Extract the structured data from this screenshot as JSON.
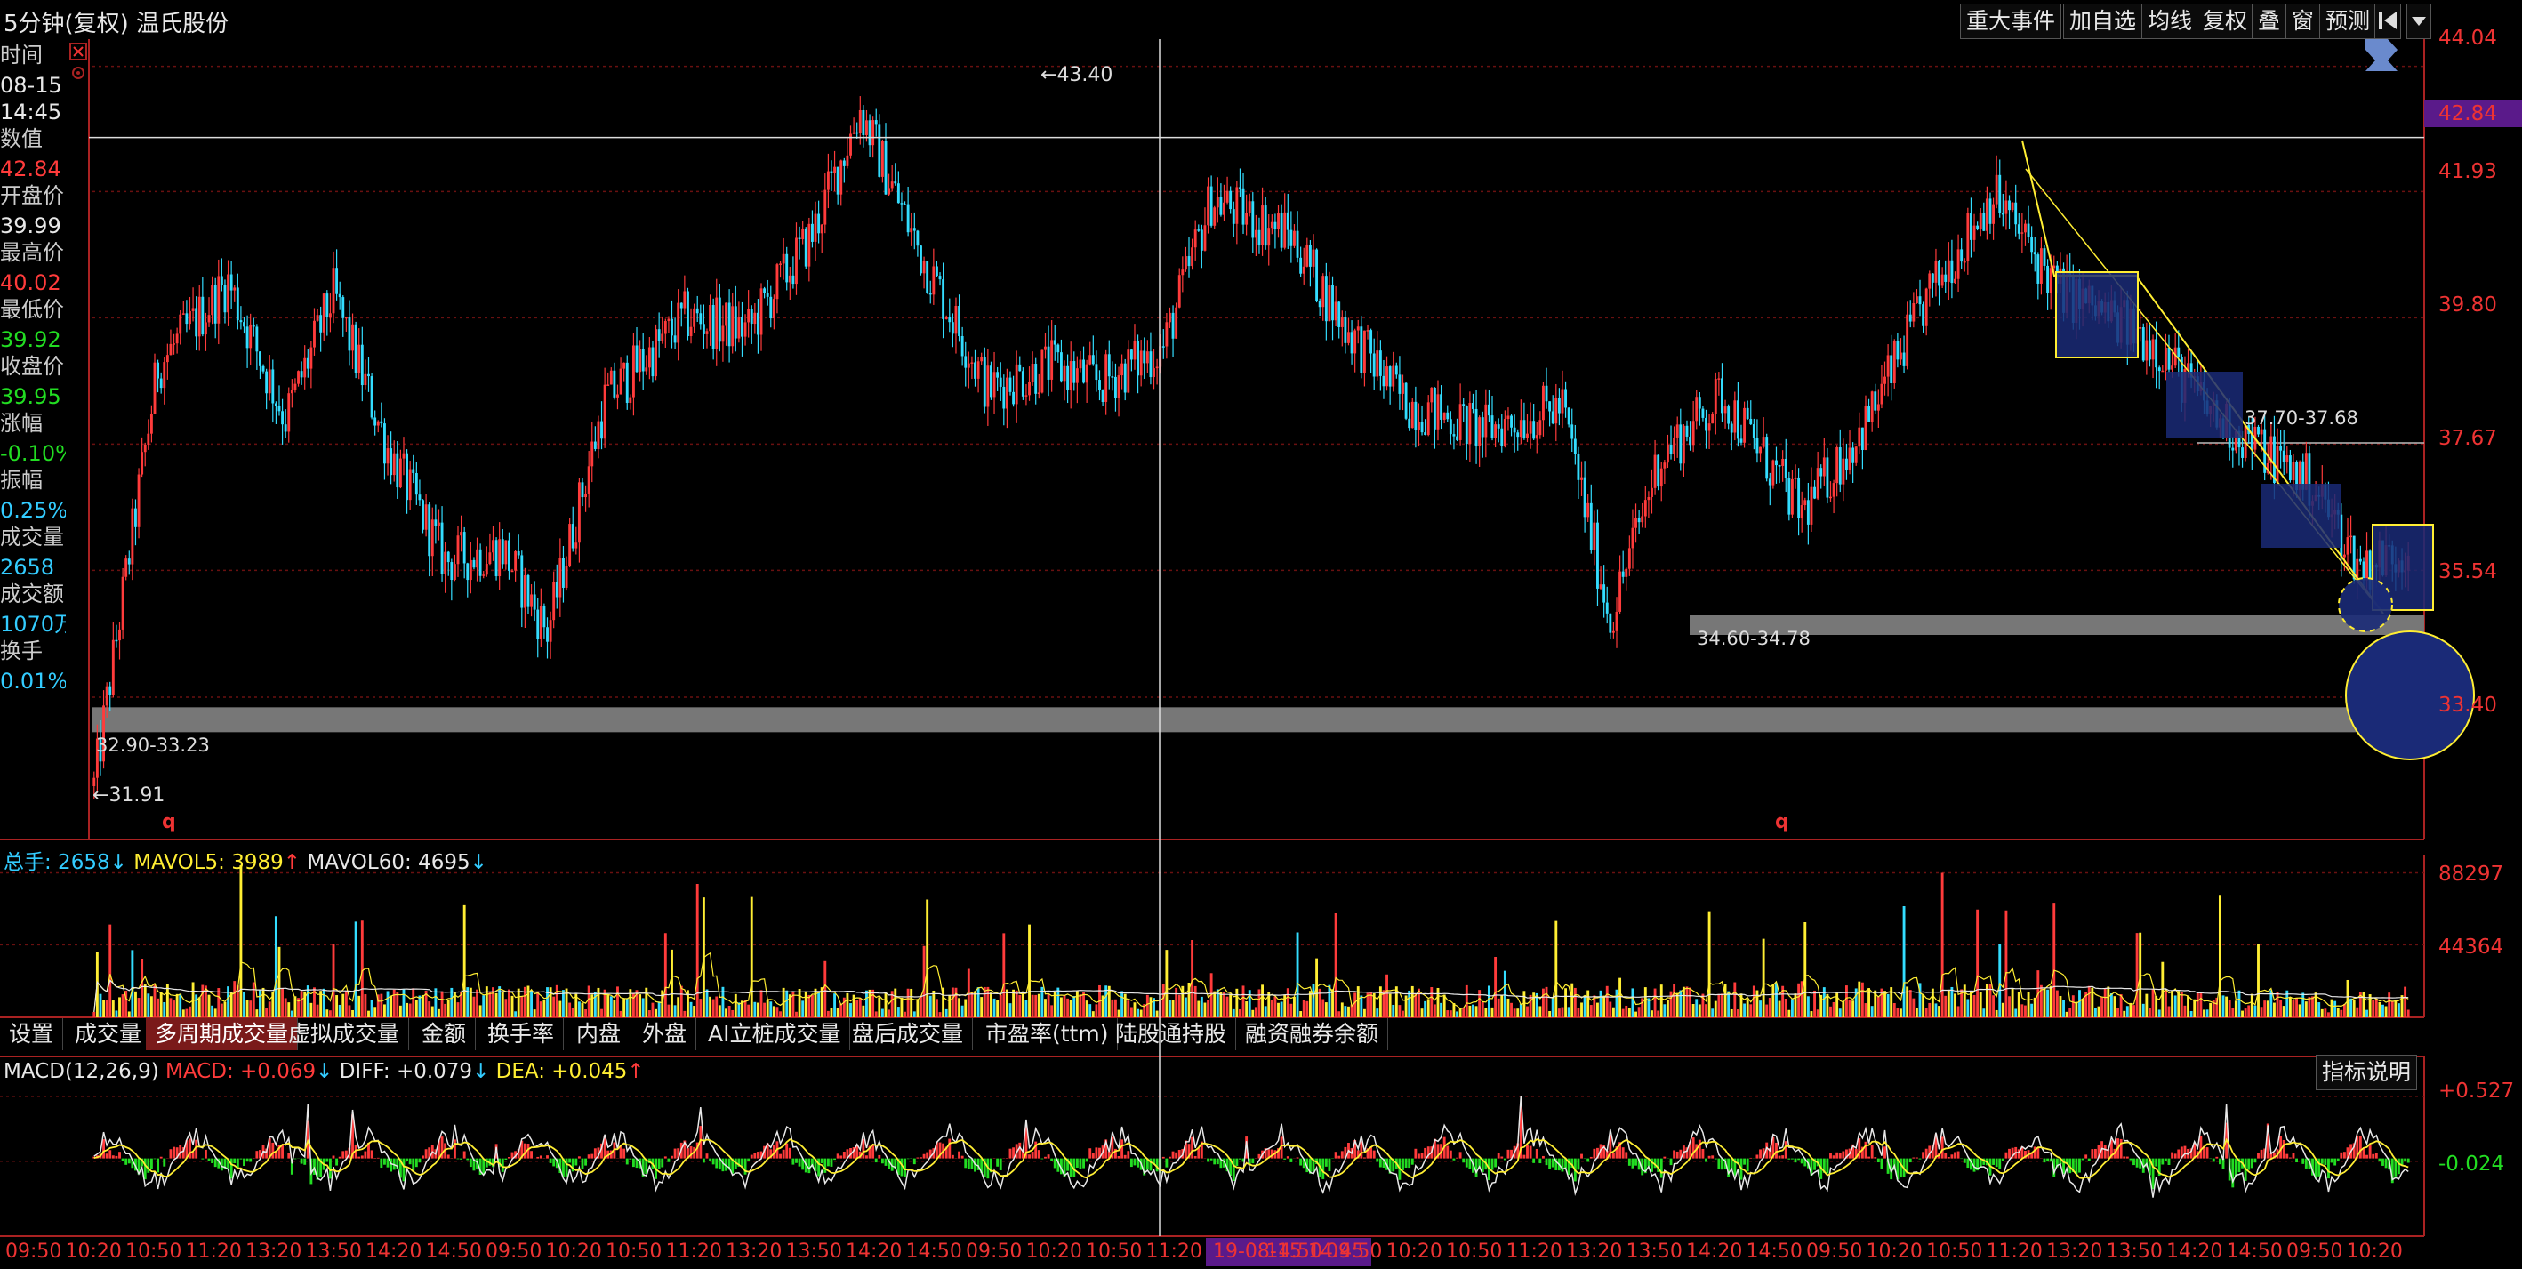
{
  "header": {
    "title": "5分钟(复权) 温氏股份",
    "buttons": [
      "重大事件",
      "加自选",
      "均线",
      "复权",
      "叠",
      "窗",
      "预测"
    ],
    "nav_icon": "skip-back-icon",
    "dropdown_icon": "caret-down-icon"
  },
  "info_panel": {
    "items": [
      {
        "label": "时间",
        "value": "08-15"
      },
      {
        "label": "",
        "value": "14:45"
      },
      {
        "label": "数值",
        "value": "42.84"
      },
      {
        "label": "开盘价",
        "value": "39.99"
      },
      {
        "label": "最高价",
        "value": "40.02"
      },
      {
        "label": "最低价",
        "value": "39.92"
      },
      {
        "label": "收盘价",
        "value": "39.95"
      },
      {
        "label": "涨幅",
        "value": "-0.10%"
      },
      {
        "label": "振幅",
        "value": "0.25%"
      },
      {
        "label": "成交量",
        "value": "2658"
      },
      {
        "label": "成交额",
        "value": "1070万"
      },
      {
        "label": "换手",
        "value": "0.01%"
      }
    ],
    "colors": {
      "label": "#e8e8e8",
      "up": "#ff3b3b",
      "down": "#22dd22",
      "neutral": "#e8e8e8",
      "cyan": "#33ccff"
    }
  },
  "price_axis": {
    "ticks": [
      "44.04",
      "42.84",
      "41.93",
      "39.80",
      "37.67",
      "35.54",
      "33.40"
    ],
    "crosshair_value": "42.84",
    "crosshair_color": "#5a1a8a"
  },
  "annotations": {
    "high": "43.40",
    "low": "31.91",
    "zone1": "34.60-34.78",
    "zone2": "32.90-33.23",
    "zone3": "37.70-37.68",
    "marker": "q"
  },
  "volume": {
    "legend": {
      "total": "总手: 2658",
      "total_dir": "↓",
      "ma5": "MAVOL5: 3989",
      "ma5_dir": "↑",
      "ma60": "MAVOL60: 4695",
      "ma60_dir": "↓"
    },
    "ticks": [
      "88297",
      "44364"
    ]
  },
  "indicator_tabs": [
    "设置",
    "成交量",
    "多周期成交量",
    "虚拟成交量",
    "金额",
    "换手率",
    "内盘",
    "外盘",
    "AI立桩成交量",
    "盘后成交量",
    "市盈率(ttm)",
    "陆股通持股",
    "融资融券余额"
  ],
  "active_tab": "多周期成交量",
  "macd": {
    "legend": {
      "name": "MACD(12,26,9)",
      "macd": "MACD: +0.069",
      "macd_dir": "↓",
      "diff": "DIFF: +0.079",
      "diff_dir": "↓",
      "dea": "DEA: +0.045",
      "dea_dir": "↑"
    },
    "ticks": [
      "+0.527",
      "-0.024"
    ],
    "help_button": "指标说明"
  },
  "x_axis": {
    "labels": [
      "09:50",
      "10:20",
      "10:50",
      "11:20",
      "13:20",
      "13:50",
      "14:20",
      "14:50",
      "09:50",
      "10:20",
      "10:50",
      "11:20",
      "13:20",
      "13:50",
      "14:20",
      "14:50",
      "09:50",
      "10:20",
      "10:50",
      "11:20",
      "19-08-15 14:45",
      "14:50",
      "09:50",
      "10:20",
      "10:50",
      "11:20",
      "13:20",
      "13:50",
      "14:20",
      "14:50",
      "09:50",
      "10:20",
      "10:50",
      "11:20",
      "13:20",
      "13:50",
      "14:20",
      "14:50",
      "09:50",
      "10:20"
    ],
    "crosshair_label": "19-08-15 14:45"
  },
  "chart_data": {
    "type": "candlestick",
    "title": "",
    "ylim": [
      31.0,
      44.5
    ],
    "crosshair_price": 42.84,
    "anchors": [
      [
        0,
        31.9
      ],
      [
        20,
        39.0
      ],
      [
        42,
        40.4
      ],
      [
        60,
        38.1
      ],
      [
        75,
        40.2
      ],
      [
        92,
        37.6
      ],
      [
        110,
        35.7
      ],
      [
        128,
        35.9
      ],
      [
        142,
        34.5
      ],
      [
        160,
        38.4
      ],
      [
        185,
        39.8
      ],
      [
        205,
        39.6
      ],
      [
        225,
        41.2
      ],
      [
        240,
        43.3
      ],
      [
        258,
        41.0
      ],
      [
        280,
        38.6
      ],
      [
        300,
        39.0
      ],
      [
        315,
        38.7
      ],
      [
        335,
        39.3
      ],
      [
        350,
        41.8
      ],
      [
        375,
        41.2
      ],
      [
        390,
        39.8
      ],
      [
        410,
        38.4
      ],
      [
        435,
        37.9
      ],
      [
        460,
        38.3
      ],
      [
        475,
        34.7
      ],
      [
        490,
        37.4
      ],
      [
        510,
        38.5
      ],
      [
        535,
        36.5
      ],
      [
        555,
        38.0
      ],
      [
        575,
        40.2
      ],
      [
        595,
        41.9
      ],
      [
        615,
        40.3
      ],
      [
        645,
        39.4
      ],
      [
        665,
        38.1
      ],
      [
        695,
        37.0
      ],
      [
        710,
        35.6
      ],
      [
        725,
        35.9
      ]
    ],
    "volume_anchors": [
      [
        0,
        12000
      ],
      [
        30,
        21000
      ],
      [
        80,
        14000
      ],
      [
        150,
        17000
      ],
      [
        250,
        15000
      ],
      [
        350,
        18000
      ],
      [
        450,
        16000
      ],
      [
        550,
        19000
      ],
      [
        650,
        15000
      ],
      [
        725,
        13000
      ]
    ],
    "volume_ylim": [
      0,
      100000
    ],
    "macd_ylim": [
      -0.6,
      0.7
    ]
  }
}
